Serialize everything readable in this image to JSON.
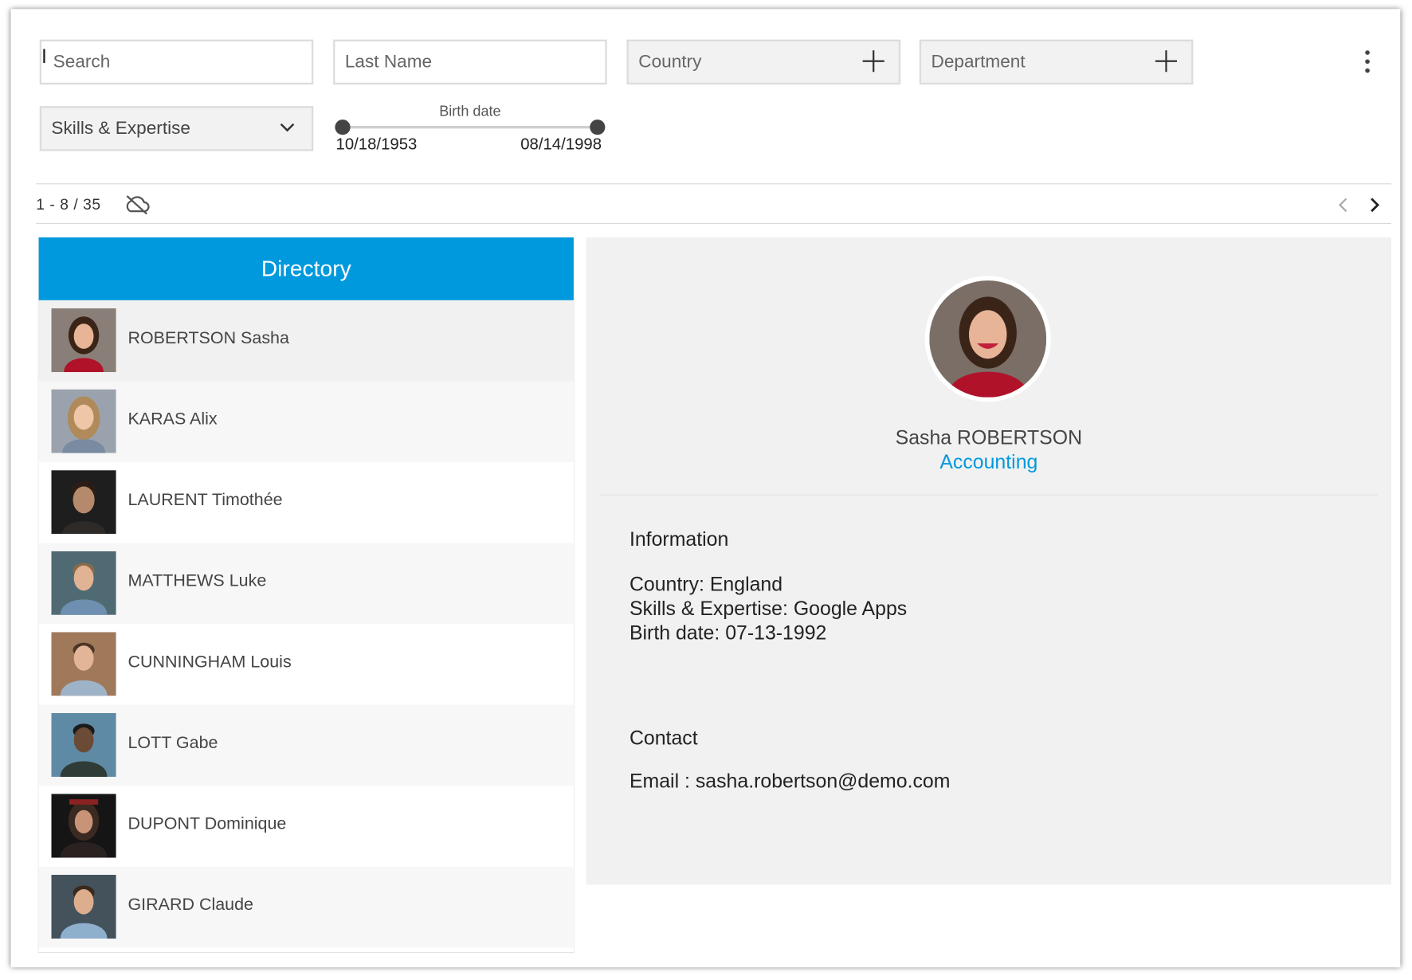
{
  "filters": {
    "search_placeholder": "Search",
    "lastname_placeholder": "Last Name",
    "country_label": "Country",
    "department_label": "Department",
    "skills_label": "Skills & Expertise",
    "birth_range": {
      "title": "Birth date",
      "min": "10/18/1953",
      "max": "08/14/1998",
      "min_fraction": 0.0,
      "max_fraction": 1.0
    }
  },
  "pager": {
    "count": "1 - 8 / 35"
  },
  "directory": {
    "title": "Directory",
    "accent": "#0099dd",
    "people": [
      {
        "name": "ROBERTSON Sasha",
        "selected": true
      },
      {
        "name": "KARAS Alix"
      },
      {
        "name": "LAURENT Timothée"
      },
      {
        "name": "MATTHEWS Luke"
      },
      {
        "name": "CUNNINGHAM Louis"
      },
      {
        "name": "LOTT Gabe"
      },
      {
        "name": "DUPONT Dominique"
      },
      {
        "name": "GIRARD Claude"
      }
    ]
  },
  "detail": {
    "full_name": "Sasha ROBERTSON",
    "department": "Accounting",
    "information_title": "Information",
    "country_label": "Country:",
    "country_value": "England",
    "skills_label": "Skills & Expertise:",
    "skills_value": "Google Apps",
    "birth_label": "Birth date:",
    "birth_value": "07-13-1992",
    "contact_title": "Contact",
    "email_label": "Email :",
    "email_value": "sasha.robertson@demo.com"
  }
}
